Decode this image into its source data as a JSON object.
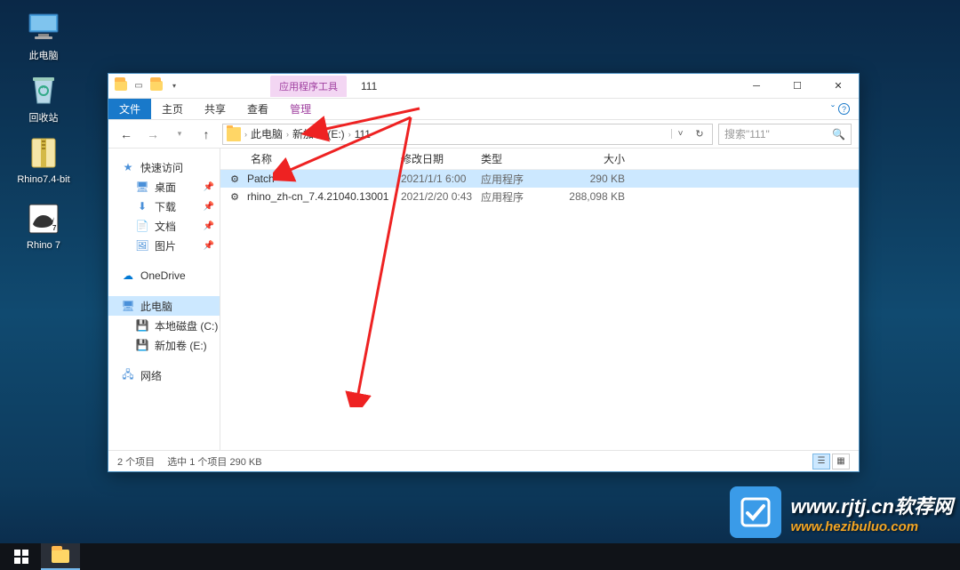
{
  "desktop": {
    "icons": [
      {
        "label": "此电脑"
      },
      {
        "label": "回收站"
      },
      {
        "label": "Rhino7.4-bit"
      },
      {
        "label": "Rhino 7"
      }
    ]
  },
  "window": {
    "context_tab": "应用程序工具",
    "title": "111",
    "ribbon": {
      "file": "文件",
      "tabs": [
        "主页",
        "共享",
        "查看"
      ],
      "context": "管理"
    },
    "breadcrumb": {
      "items": [
        "此电脑",
        "新加卷 (E:)",
        "111"
      ]
    },
    "search": {
      "placeholder": "搜索\"111\""
    },
    "nav_pane": {
      "quick_access": "快速访问",
      "quick_items": [
        "桌面",
        "下载",
        "文档",
        "图片"
      ],
      "onedrive": "OneDrive",
      "this_pc": "此电脑",
      "drives": [
        "本地磁盘 (C:)",
        "新加卷 (E:)"
      ],
      "network": "网络"
    },
    "columns": {
      "name": "名称",
      "date": "修改日期",
      "type": "类型",
      "size": "大小"
    },
    "files": [
      {
        "name": "Patch",
        "date": "2021/1/1 6:00",
        "type": "应用程序",
        "size": "290 KB"
      },
      {
        "name": "rhino_zh-cn_7.4.21040.13001",
        "date": "2021/2/20 0:43",
        "type": "应用程序",
        "size": "288,098 KB"
      }
    ],
    "statusbar": {
      "count": "2 个项目",
      "selected": "选中 1 个项目 290 KB"
    }
  },
  "watermark": {
    "url_top": "www.rjtj.cn软荐网",
    "url_bottom": "www.hezibuluo.com"
  }
}
